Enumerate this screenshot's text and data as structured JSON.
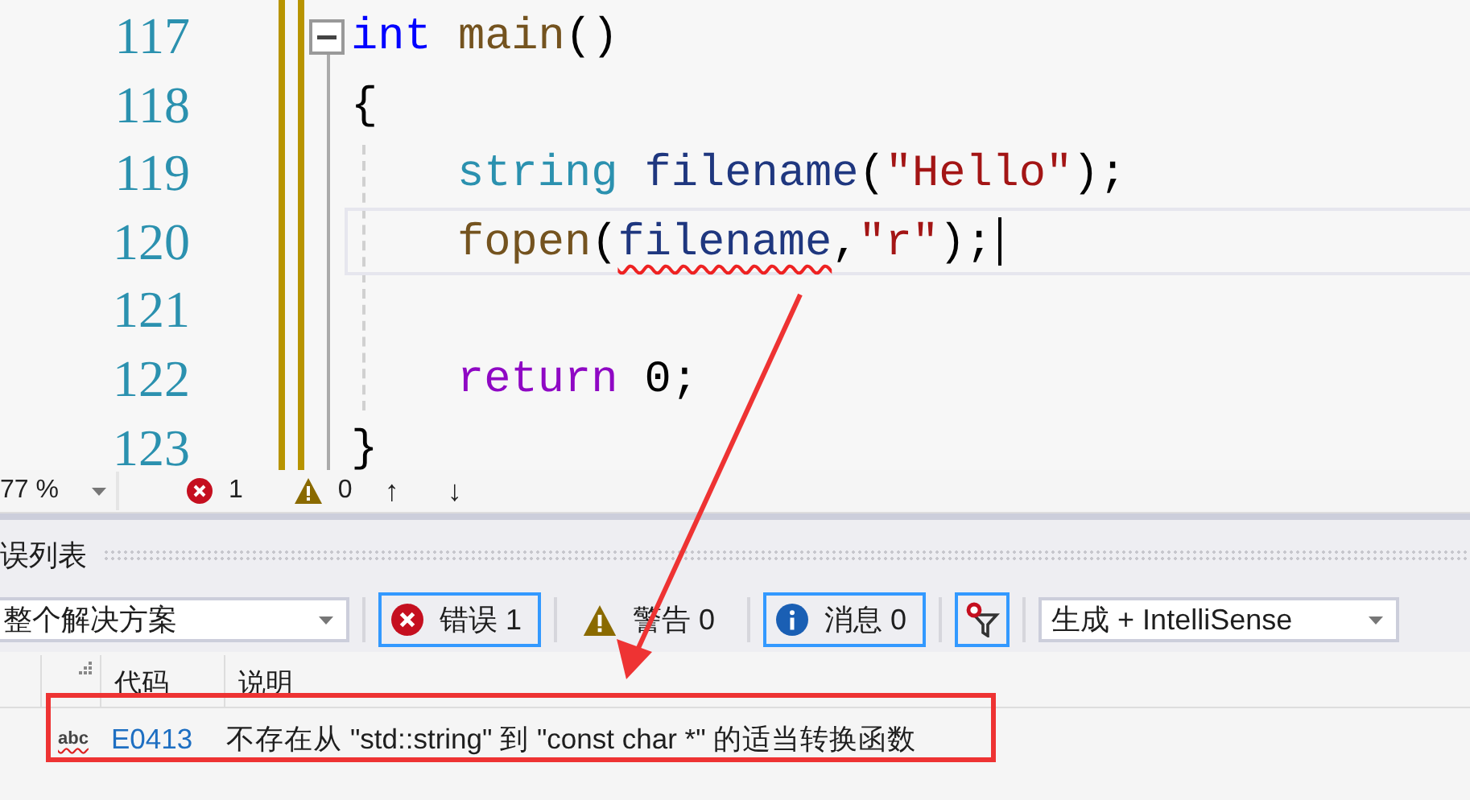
{
  "editor": {
    "lines": [
      {
        "number": "117",
        "fold_marker": true,
        "indented": false,
        "current": false,
        "tokens": [
          {
            "kind": "keyword",
            "text": "int"
          },
          {
            "kind": "function",
            "text": "main",
            "space_before": true
          },
          {
            "kind": "plain",
            "text": "()"
          }
        ]
      },
      {
        "number": "118",
        "fold_marker": false,
        "indented": false,
        "current": false,
        "tokens": [
          {
            "kind": "plain",
            "text": "{"
          }
        ]
      },
      {
        "number": "119",
        "fold_marker": false,
        "indented": true,
        "current": false,
        "tokens": [
          {
            "kind": "type",
            "text": "string"
          },
          {
            "kind": "variable",
            "text": "filename",
            "space_before": true
          },
          {
            "kind": "plain",
            "text": "("
          },
          {
            "kind": "string",
            "text": "\"Hello\""
          },
          {
            "kind": "plain",
            "text": ");"
          }
        ]
      },
      {
        "number": "120",
        "fold_marker": false,
        "indented": true,
        "current": true,
        "tokens": [
          {
            "kind": "function",
            "text": "fopen"
          },
          {
            "kind": "plain",
            "text": "("
          },
          {
            "kind": "variable",
            "text": "filename",
            "squiggle": true
          },
          {
            "kind": "plain",
            "text": ","
          },
          {
            "kind": "string",
            "text": "\"r\""
          },
          {
            "kind": "plain",
            "text": ");"
          }
        ]
      },
      {
        "number": "121",
        "fold_marker": false,
        "current": false
      },
      {
        "number": "122",
        "fold_marker": false,
        "indented": true,
        "current": false,
        "tokens": [
          {
            "kind": "control",
            "text": "return"
          },
          {
            "kind": "plain",
            "text": "0;",
            "space_before": true
          }
        ]
      },
      {
        "number": "123",
        "fold_marker": false,
        "indented": false,
        "current": false,
        "tokens": [
          {
            "kind": "plain",
            "text": "}"
          }
        ]
      }
    ]
  },
  "status_bar": {
    "zoom": "77 %",
    "errors": "1",
    "warnings": "0",
    "nav": [
      "↑",
      "↓"
    ]
  },
  "error_list": {
    "title": "误列表",
    "scope": "整个解决方案",
    "filters": [
      {
        "kind": "error",
        "label": "错误 1",
        "selected": true
      },
      {
        "kind": "warning",
        "label": "警告 0",
        "selected": false
      },
      {
        "kind": "info",
        "label": "消息 0",
        "selected": true
      }
    ],
    "filter_toggle": {
      "selected": true
    },
    "source": "生成 + IntelliSense",
    "columns": [
      "代码",
      "说明"
    ],
    "rows": [
      {
        "icon_text": "abc",
        "code": "E0413",
        "description": "不存在从 \"std::string\" 到 \"const char *\" 的适当转换函数"
      }
    ]
  }
}
